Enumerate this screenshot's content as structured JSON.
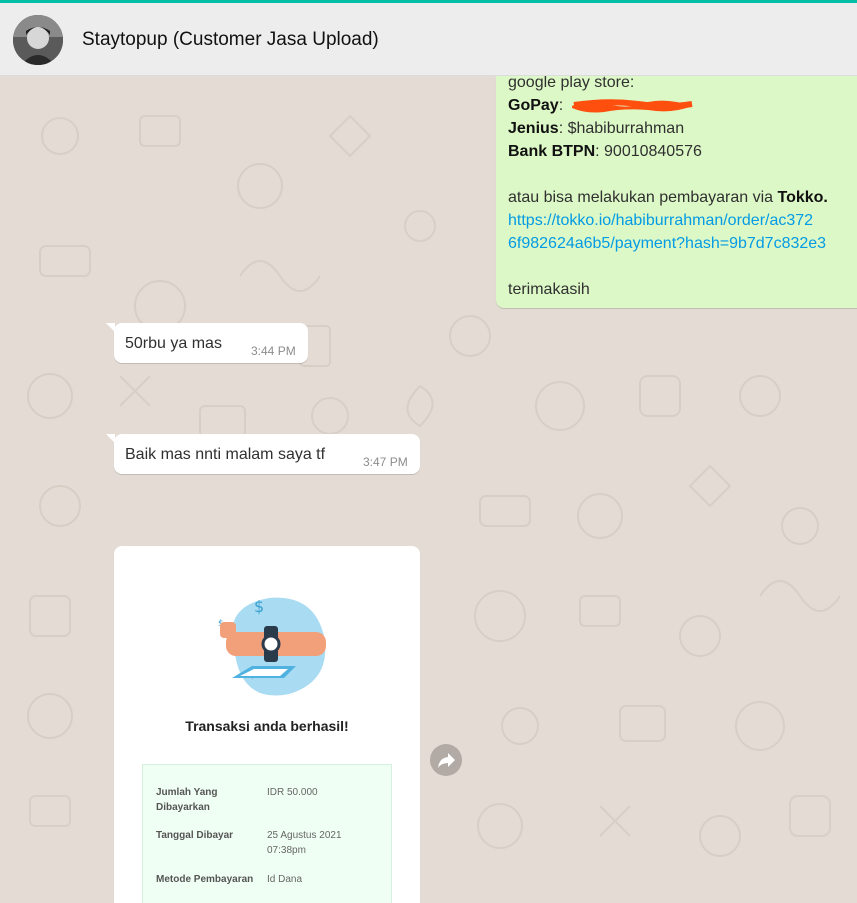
{
  "header": {
    "contact_name": "Staytopup (Customer Jasa Upload)"
  },
  "outgoing": {
    "line_intro": "google play store:",
    "gopay_label": "GoPay",
    "jenius_label": "Jenius",
    "jenius_value": ": $habiburrahman",
    "btpn_label": "Bank BTPN",
    "btpn_value": ": 90010840576",
    "tokko_text": "atau bisa melakukan pembayaran via ",
    "tokko_label": "Tokko.",
    "link_line1": "https://tokko.io/habiburrahman/order/ac372",
    "link_line2": "6f982624a6b5/payment?hash=9b7d7c832e3",
    "closing": "terimakasih"
  },
  "messages": [
    {
      "text": "50rbu ya mas",
      "time": "3:44 PM"
    },
    {
      "text": "Baik mas nnti malam saya tf",
      "time": "3:47 PM"
    }
  ],
  "receipt": {
    "title": "Transaksi anda berhasil!",
    "rows": [
      {
        "label": "Jumlah Yang Dibayarkan",
        "value": "IDR 50.000"
      },
      {
        "label": "Tanggal Dibayar",
        "value": "25 Agustus 2021 07:38pm"
      },
      {
        "label": "Metode Pembayaran",
        "value": "Id Dana"
      }
    ]
  },
  "colors": {
    "accent": "#00bfa5",
    "header_bg": "#ededed",
    "chat_bg": "#e4dcd4",
    "outgoing_bubble": "#dcf8c6",
    "incoming_bubble": "#ffffff",
    "link": "#039be5",
    "redaction": "#ff4f0f"
  },
  "icons": {
    "forward": "forward-arrow-icon"
  }
}
